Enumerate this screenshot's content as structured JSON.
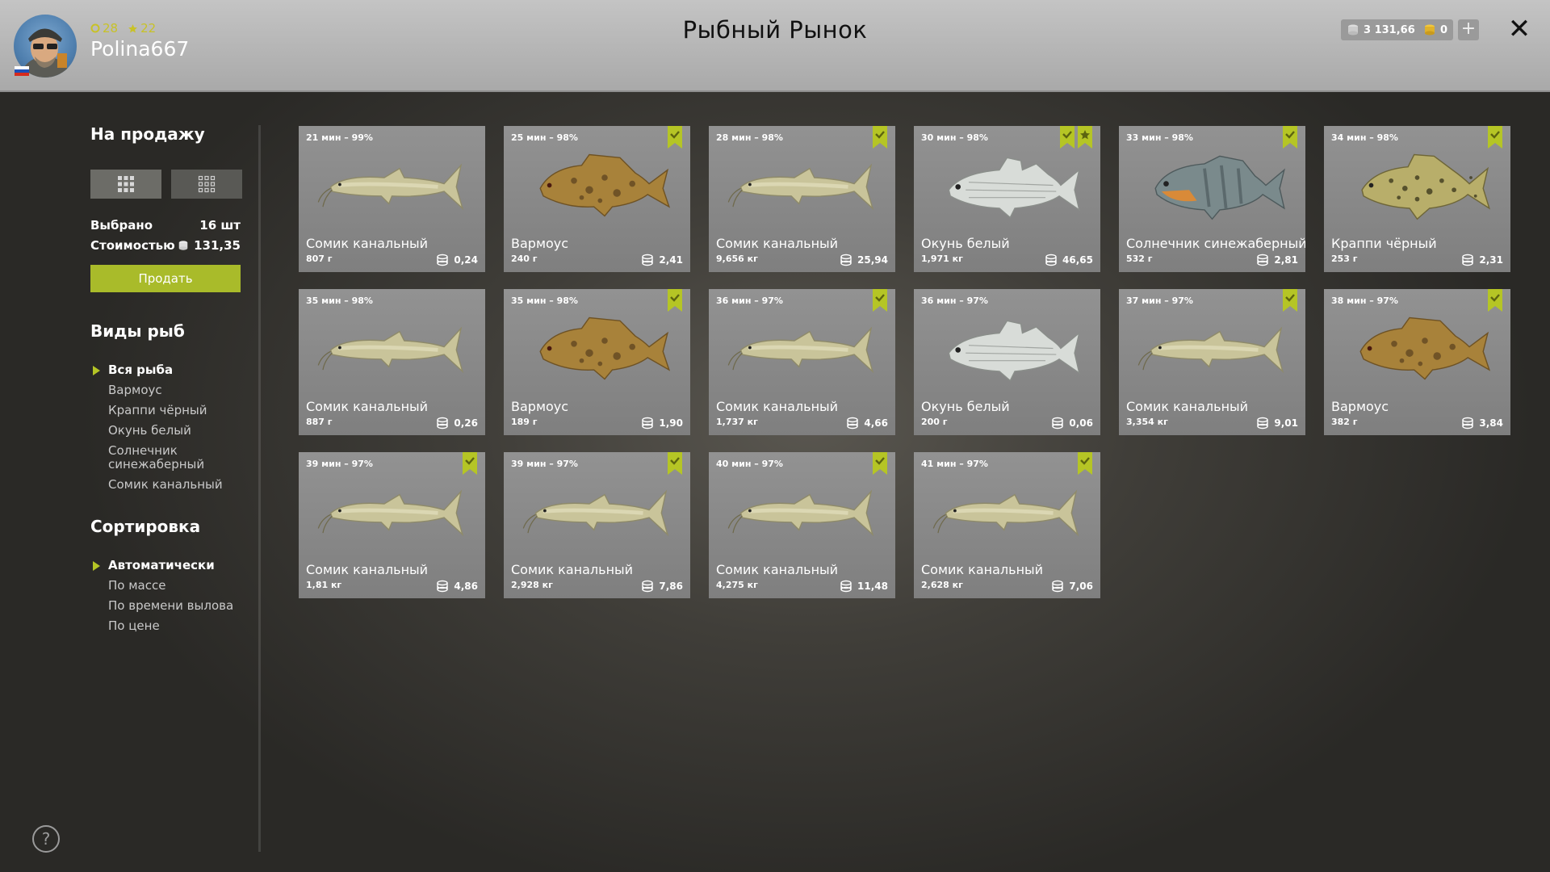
{
  "header": {
    "title": "Рыбный Рынок",
    "username": "Polina667",
    "level": "28",
    "stars": "22",
    "silver": "3 131,66",
    "gold": "0"
  },
  "sidebar": {
    "sale_title": "На продажу",
    "selected_label": "Выбрано",
    "selected_value": "16 шт",
    "cost_label": "Стоимостью",
    "cost_value": "131,35",
    "sell_button": "Продать",
    "species_title": "Виды рыб",
    "species": [
      "Вся рыба",
      "Вармоус",
      "Краппи чёрный",
      "Окунь белый",
      "Солнечник синежаберный",
      "Сомик канальный"
    ],
    "sort_title": "Сортировка",
    "sort": [
      "Автоматически",
      "По массе",
      "По времени вылова",
      "По цене"
    ]
  },
  "colors": {
    "accent": "#b5c525",
    "card_bg": "#8a8a8a",
    "header_bg": "#b8b8b8"
  },
  "cards": [
    {
      "time": "21 мин – 99%",
      "name": "Сомик канальный",
      "weight": "807 г",
      "price": "0,24",
      "fish": "catfish",
      "check": false,
      "star": false
    },
    {
      "time": "25 мин – 98%",
      "name": "Вармоус",
      "weight": "240 г",
      "price": "2,41",
      "fish": "warmouth",
      "check": true,
      "star": false
    },
    {
      "time": "28 мин – 98%",
      "name": "Сомик канальный",
      "weight": "9,656 кг",
      "price": "25,94",
      "fish": "catfish",
      "check": true,
      "star": false
    },
    {
      "time": "30 мин – 98%",
      "name": "Окунь белый",
      "weight": "1,971 кг",
      "price": "46,65",
      "fish": "whitebass",
      "check": true,
      "star": true
    },
    {
      "time": "33 мин – 98%",
      "name": "Солнечник синежаберный",
      "weight": "532 г",
      "price": "2,81",
      "fish": "bluegill",
      "check": true,
      "star": false
    },
    {
      "time": "34 мин – 98%",
      "name": "Краппи чёрный",
      "weight": "253 г",
      "price": "2,31",
      "fish": "crappie",
      "check": true,
      "star": false
    },
    {
      "time": "35 мин – 98%",
      "name": "Сомик канальный",
      "weight": "887 г",
      "price": "0,26",
      "fish": "catfish",
      "check": false,
      "star": false
    },
    {
      "time": "35 мин – 98%",
      "name": "Вармоус",
      "weight": "189 г",
      "price": "1,90",
      "fish": "warmouth",
      "check": true,
      "star": false
    },
    {
      "time": "36 мин – 97%",
      "name": "Сомик канальный",
      "weight": "1,737 кг",
      "price": "4,66",
      "fish": "catfish",
      "check": true,
      "star": false
    },
    {
      "time": "36 мин – 97%",
      "name": "Окунь белый",
      "weight": "200 г",
      "price": "0,06",
      "fish": "whitebass",
      "check": false,
      "star": false
    },
    {
      "time": "37 мин – 97%",
      "name": "Сомик канальный",
      "weight": "3,354 кг",
      "price": "9,01",
      "fish": "catfish",
      "check": true,
      "star": false
    },
    {
      "time": "38 мин – 97%",
      "name": "Вармоус",
      "weight": "382 г",
      "price": "3,84",
      "fish": "warmouth",
      "check": true,
      "star": false
    },
    {
      "time": "39 мин – 97%",
      "name": "Сомик канальный",
      "weight": "1,81 кг",
      "price": "4,86",
      "fish": "catfish",
      "check": true,
      "star": false
    },
    {
      "time": "39 мин – 97%",
      "name": "Сомик канальный",
      "weight": "2,928 кг",
      "price": "7,86",
      "fish": "catfish",
      "check": true,
      "star": false
    },
    {
      "time": "40 мин – 97%",
      "name": "Сомик канальный",
      "weight": "4,275 кг",
      "price": "11,48",
      "fish": "catfish",
      "check": true,
      "star": false
    },
    {
      "time": "41 мин – 97%",
      "name": "Сомик канальный",
      "weight": "2,628 кг",
      "price": "7,06",
      "fish": "catfish",
      "check": true,
      "star": false
    }
  ]
}
